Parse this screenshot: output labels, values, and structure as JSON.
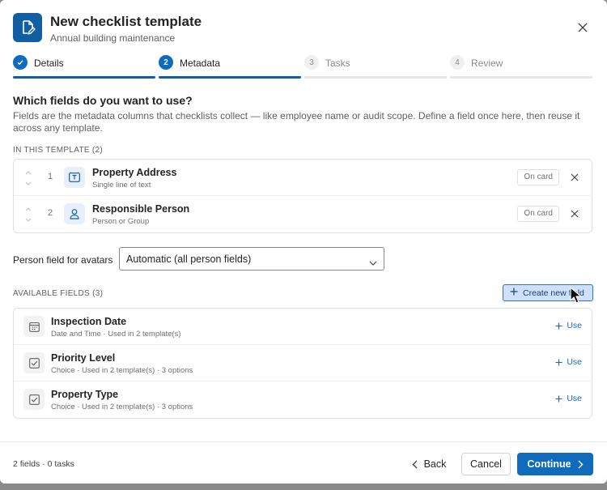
{
  "header": {
    "title": "New checklist template",
    "subtitle": "Annual building maintenance",
    "icon": "document-edit-icon",
    "close_icon": "close-icon"
  },
  "stepper": {
    "steps": [
      {
        "num": "",
        "label": "Details",
        "state": "done"
      },
      {
        "num": "2",
        "label": "Metadata",
        "state": "active"
      },
      {
        "num": "3",
        "label": "Tasks",
        "state": "todo"
      },
      {
        "num": "4",
        "label": "Review",
        "state": "todo"
      }
    ]
  },
  "section": {
    "title": "Which fields do you want to use?",
    "description": "Fields are the metadata columns that checklists collect — like employee name or audit scope. Define a field once here, then reuse it across any template."
  },
  "in_template": {
    "label": "IN THIS TEMPLATE (2)",
    "fields": [
      {
        "index": "1",
        "name": "Property Address",
        "type": "Single line of text",
        "icon": "text-field-icon",
        "badge": "On card"
      },
      {
        "index": "2",
        "name": "Responsible Person",
        "type": "Person or Group",
        "icon": "person-icon",
        "badge": "On card"
      }
    ]
  },
  "avatar_field": {
    "label": "Person field for avatars",
    "value": "Automatic (all person fields)"
  },
  "available": {
    "label": "AVAILABLE FIELDS (3)",
    "create_button": "Create new field",
    "use_label": "Use",
    "fields": [
      {
        "name": "Inspection Date",
        "meta": "Date and Time · Used in 2 template(s)",
        "icon": "calendar-icon"
      },
      {
        "name": "Priority Level",
        "meta": "Choice · Used in 2 template(s) · 3 options",
        "icon": "checkbox-icon"
      },
      {
        "name": "Property Type",
        "meta": "Choice · Used in 2 template(s) · 3 options",
        "icon": "checkbox-icon"
      }
    ]
  },
  "footer": {
    "count": "2 fields · 0 tasks",
    "back": "Back",
    "cancel": "Cancel",
    "continue": "Continue"
  },
  "colors": {
    "accent": "#0f6cbd",
    "accent_dark": "#115ea3"
  }
}
